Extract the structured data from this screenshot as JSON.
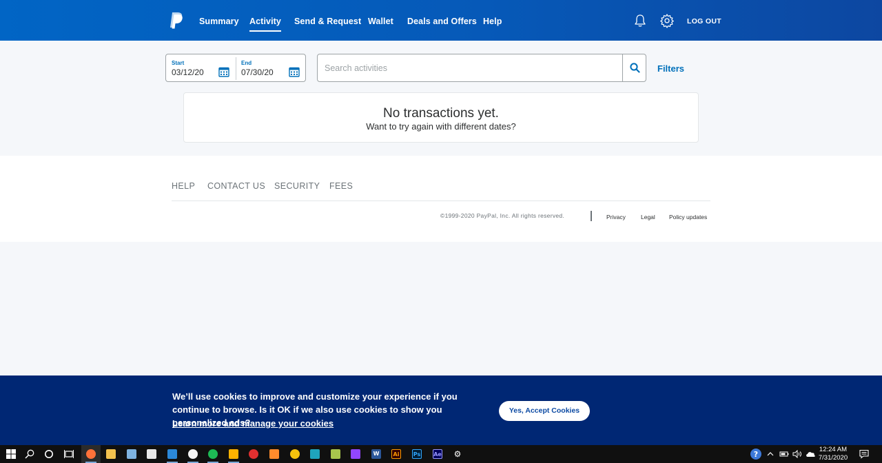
{
  "header": {
    "nav": [
      "Summary",
      "Activity",
      "Send & Request",
      "Wallet",
      "Deals and Offers",
      "Help"
    ],
    "active": "Activity",
    "logout": "LOG OUT"
  },
  "filters": {
    "start_label": "Start",
    "start_value": "03/12/20",
    "end_label": "End",
    "end_value": "07/30/20",
    "search_placeholder": "Search activities",
    "filters_label": "Filters"
  },
  "empty_state": {
    "title": "No transactions yet.",
    "subtitle": "Want to try again with different dates?"
  },
  "footer": {
    "links": [
      "HELP",
      "CONTACT US",
      "SECURITY",
      "FEES"
    ],
    "copyright": "©1999-2020 PayPal, Inc. All rights reserved.",
    "legal_links": [
      "Privacy",
      "Legal",
      "Policy updates"
    ]
  },
  "cookie_banner": {
    "text": "We’ll use cookies to improve and customize your experience if you continue to browse. Is it OK if we also use cookies to show you personalized ads?",
    "manage_link": "Learn more and manage your cookies",
    "accept_button": "Yes, Accept Cookies"
  },
  "taskbar": {
    "apps": [
      "firefox-icon",
      "file-explorer-icon",
      "remote-desktop-icon",
      "store-icon",
      "mail-icon",
      "itunes-icon",
      "spotify-icon",
      "media-player-icon",
      "target-icon",
      "sublime-icon",
      "chrome-icon",
      "maya-icon",
      "unity-icon",
      "twitch-icon",
      "word-icon",
      "illustrator-icon",
      "photoshop-icon",
      "after-effects-icon",
      "settings-icon"
    ],
    "app_badges": {
      "word-icon": "W",
      "illustrator-icon": "Ai",
      "photoshop-icon": "Ps",
      "after-effects-icon": "Ae"
    },
    "time": "12:24 AM",
    "date": "7/31/2020"
  },
  "colors": {
    "brand_blue": "#0070ba",
    "header_gradient_start": "#0165c5",
    "header_gradient_end": "#0d47a1",
    "cookie_banner_bg": "#002774",
    "page_bg": "#f5f7fa"
  }
}
